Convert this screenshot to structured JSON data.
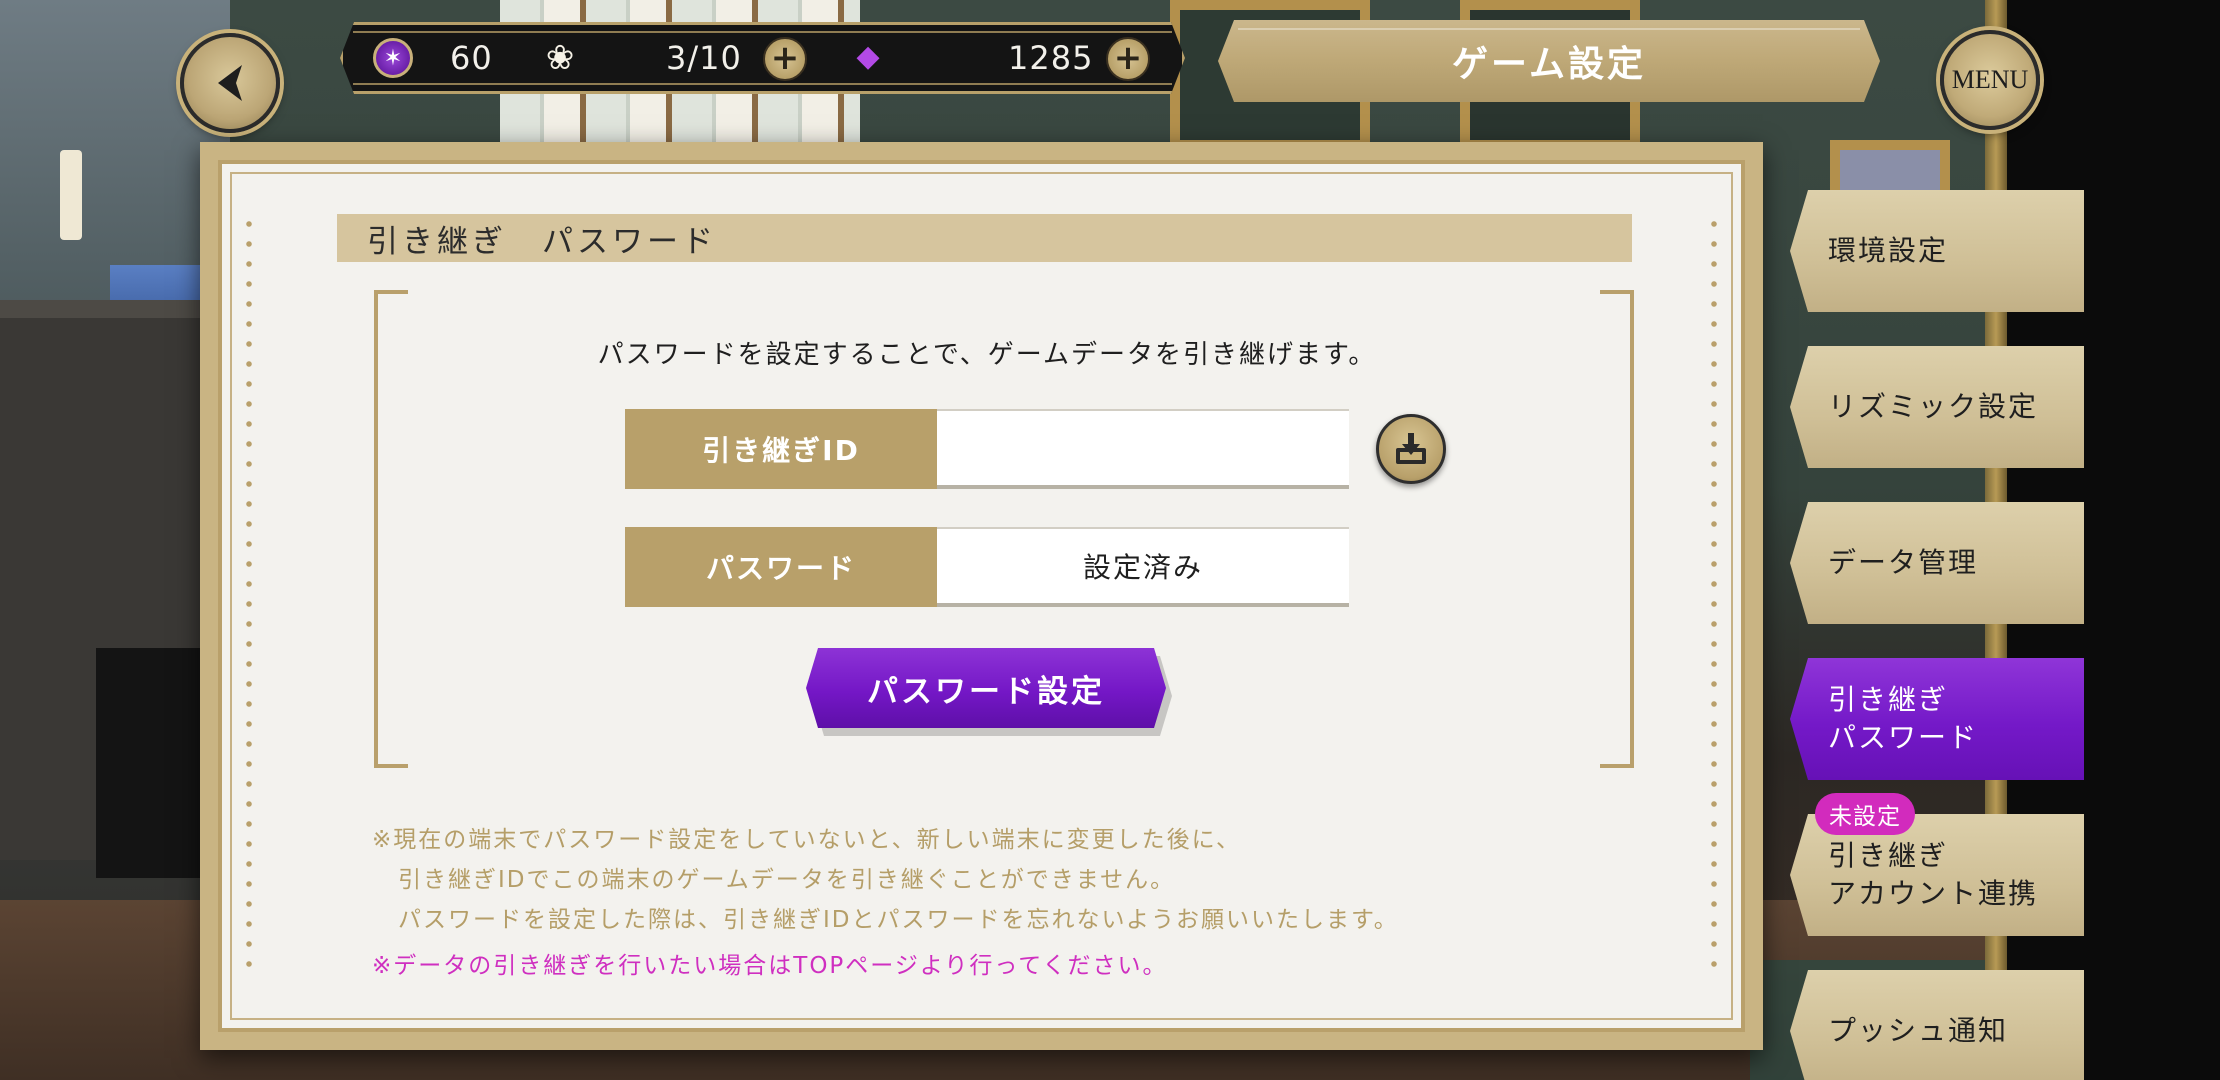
{
  "header": {
    "title": "ゲーム設定",
    "menu_label": "MENU",
    "resources": {
      "energy": "60",
      "flower": "3/10",
      "crystal": "1285"
    }
  },
  "panel": {
    "section_title": "引き継ぎ　パスワード",
    "description": "パスワードを設定することで、ゲームデータを引き継げます。",
    "transfer_id": {
      "label": "引き継ぎID",
      "value": ""
    },
    "password": {
      "label": "パスワード",
      "value": "設定済み"
    },
    "set_password_button": "パスワード設定",
    "notes": [
      "※現在の端末でパスワード設定をしていないと、新しい端末に変更した後に、",
      "引き継ぎIDでこの端末のゲームデータを引き継ぐことができません。",
      "パスワードを設定した際は、引き継ぎIDとパスワードを忘れないようお願いいたします。"
    ],
    "warning": "※データの引き継ぎを行いたい場合はTOPページより行ってください。"
  },
  "sidebar": {
    "items": [
      {
        "label": "環境設定",
        "active": false
      },
      {
        "label": "リズミック設定",
        "active": false
      },
      {
        "label": "データ管理",
        "active": false
      },
      {
        "label": "引き継ぎ\nパスワード",
        "active": true
      },
      {
        "label": "引き継ぎ\nアカウント連携",
        "active": false,
        "badge": "未設定"
      },
      {
        "label": "プッシュ通知",
        "active": false
      }
    ]
  },
  "colors": {
    "accent_purple": "#7419c8",
    "gold": "#b8a06a",
    "warning_magenta": "#cf2fc0",
    "panel_bg": "#f3f2ee"
  },
  "icons": [
    "back-arrow-icon",
    "energy-icon",
    "flower-icon",
    "crystal-icon",
    "plus-icon",
    "download-icon"
  ]
}
